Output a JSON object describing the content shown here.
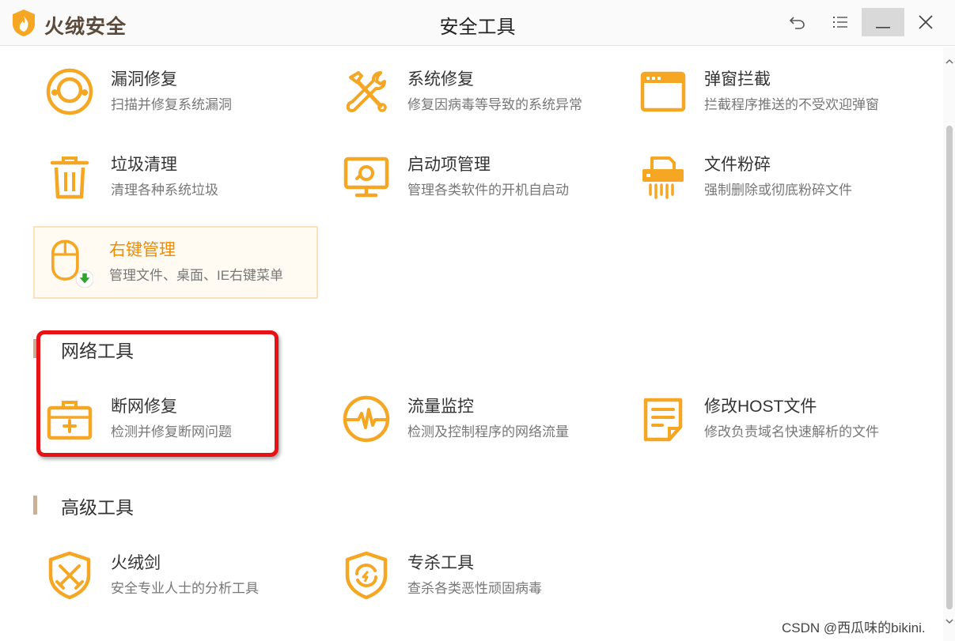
{
  "app": {
    "brand": "火绒安全",
    "window_title": "安全工具"
  },
  "colors": {
    "accent": "#f5a623",
    "highlight_text": "#f08c00",
    "annotation": "#e81216"
  },
  "titlebar_buttons": [
    "undo-icon",
    "menu-icon",
    "minimize-icon",
    "close-icon"
  ],
  "tools": {
    "vuln_fix": {
      "name": "漏洞修复",
      "desc": "扫描并修复系统漏洞",
      "icon": "headset-icon"
    },
    "sys_fix": {
      "name": "系统修复",
      "desc": "修复因病毒等导致的系统异常",
      "icon": "wrench-icon"
    },
    "popup_block": {
      "name": "弹窗拦截",
      "desc": "拦截程序推送的不受欢迎弹窗",
      "icon": "window-icon"
    },
    "trash_clean": {
      "name": "垃圾清理",
      "desc": "清理各种系统垃圾",
      "icon": "trash-icon"
    },
    "startup_mgr": {
      "name": "启动项管理",
      "desc": "管理各类软件的开机自启动",
      "icon": "monitor-icon"
    },
    "file_shred": {
      "name": "文件粉碎",
      "desc": "强制删除或彻底粉碎文件",
      "icon": "shredder-icon"
    },
    "rclick_mgr": {
      "name": "右键管理",
      "desc": "管理文件、桌面、IE右键菜单",
      "icon": "mouse-icon"
    },
    "net_fix": {
      "name": "断网修复",
      "desc": "检测并修复断网问题",
      "icon": "toolbox-icon"
    },
    "traffic_mon": {
      "name": "流量监控",
      "desc": "检测及控制程序的网络流量",
      "icon": "pulse-icon"
    },
    "host_edit": {
      "name": "修改HOST文件",
      "desc": "修改负责域名快速解析的文件",
      "icon": "note-icon"
    },
    "sword": {
      "name": "火绒剑",
      "desc": "安全专业人士的分析工具",
      "icon": "swords-shield-icon"
    },
    "killer": {
      "name": "专杀工具",
      "desc": "查杀各类恶性顽固病毒",
      "icon": "refresh-shield-icon"
    }
  },
  "sections": {
    "network": "网络工具",
    "advanced": "高级工具"
  },
  "watermark": "CSDN @西瓜味的bikini."
}
